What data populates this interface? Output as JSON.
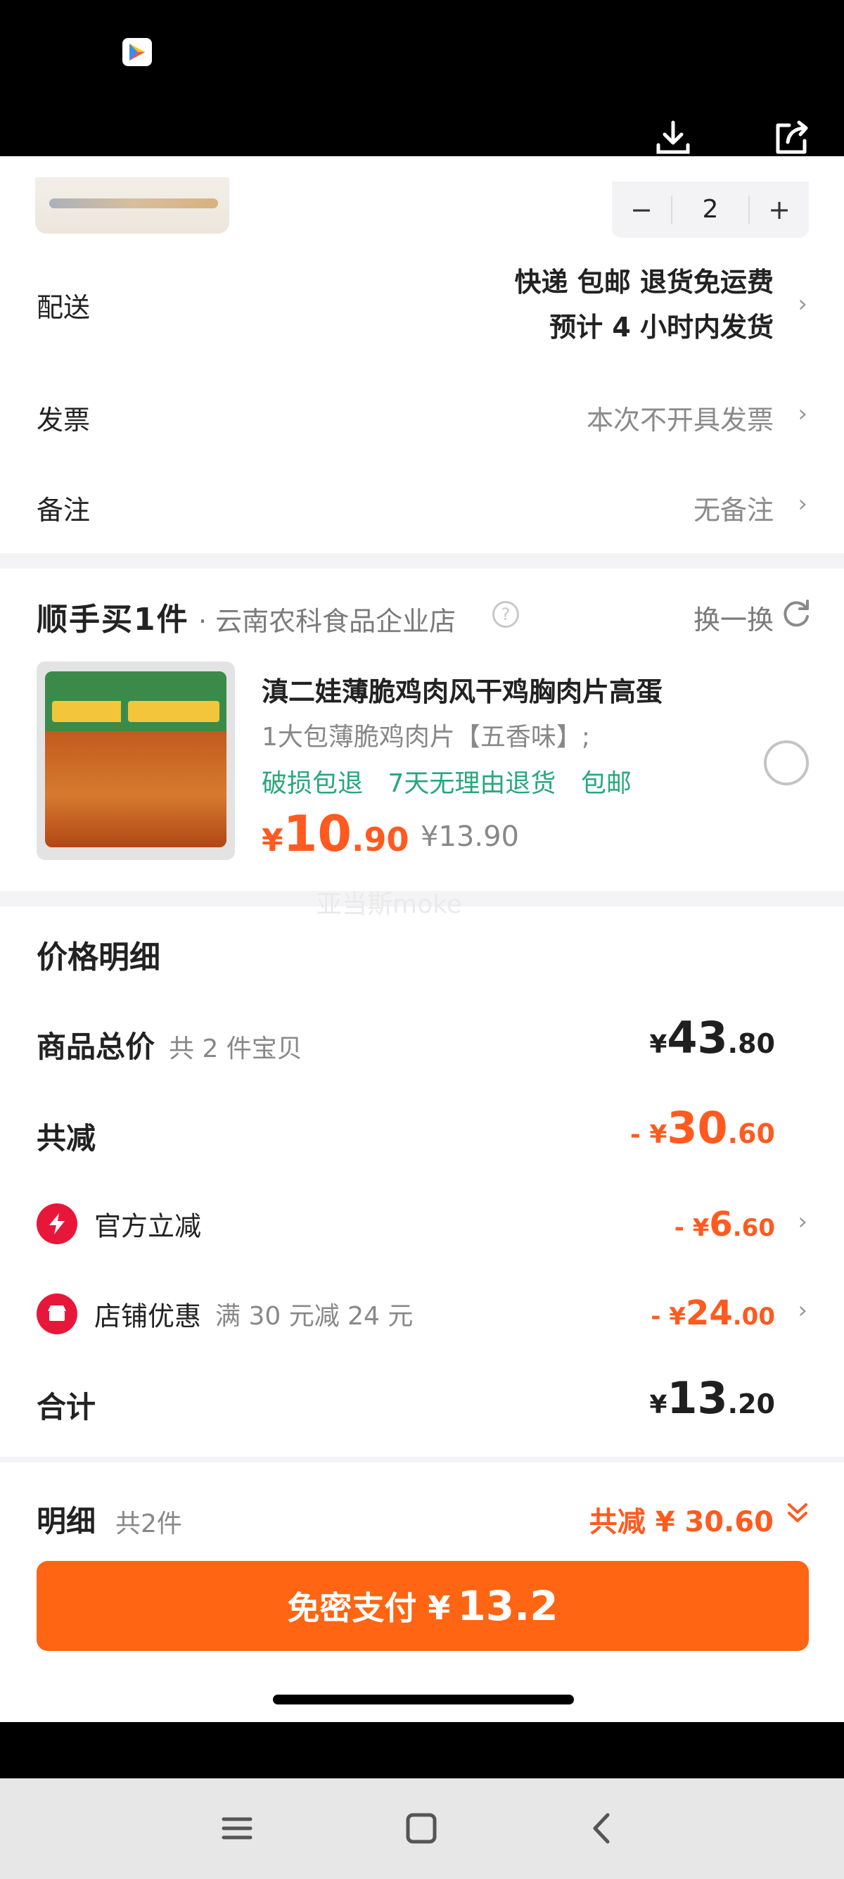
{
  "order": {
    "quantity": "2",
    "minus": "−",
    "plus": "+"
  },
  "delivery": {
    "label": "配送",
    "line1": "快递 包邮 退货免运费",
    "line2": "预计 4 小时内发货"
  },
  "invoice": {
    "label": "发票",
    "value": "本次不开具发票"
  },
  "remark": {
    "label": "备注",
    "value": "无备注"
  },
  "addon": {
    "title": "顺手买1件",
    "store": "· 云南农科食品企业店",
    "swap": "换一换",
    "name": "滇二娃薄脆鸡肉风干鸡胸肉片高蛋",
    "sku": "1大包薄脆鸡肉片【五香味】;",
    "tags": [
      "破损包退",
      "7天无理由退货",
      "包邮"
    ],
    "price_currency": "¥",
    "price_int": "10",
    "price_dec": ".90",
    "original_price": "¥13.90"
  },
  "watermark": "亚当斯moke",
  "price_detail": {
    "title": "价格明细",
    "total_label": "商品总价",
    "total_sub": "共 2 件宝贝",
    "total_cur": "¥",
    "total_int": "43",
    "total_dec": ".80",
    "reduce_label": "共减",
    "reduce_cur": "- ¥",
    "reduce_int": "30",
    "reduce_dec": ".60",
    "official_label": "官方立减",
    "official_cur": "- ¥",
    "official_int": "6",
    "official_dec": ".60",
    "shop_label": "店铺优惠",
    "shop_sub": "满 30 元减 24 元",
    "shop_cur": "- ¥",
    "shop_int": "24",
    "shop_dec": ".00",
    "sum_label": "合计",
    "sum_cur": "¥",
    "sum_int": "13",
    "sum_dec": ".20"
  },
  "footer": {
    "label": "明细",
    "count": "共2件",
    "reduce": "共减 ¥ 30.60",
    "pay_label": "免密支付 ¥",
    "pay_amount": "13.2"
  },
  "colors": {
    "accent": "#ff6513",
    "discount": "#ff5a1f",
    "tag_green": "#27a87a",
    "badge_red": "#e8173a"
  }
}
